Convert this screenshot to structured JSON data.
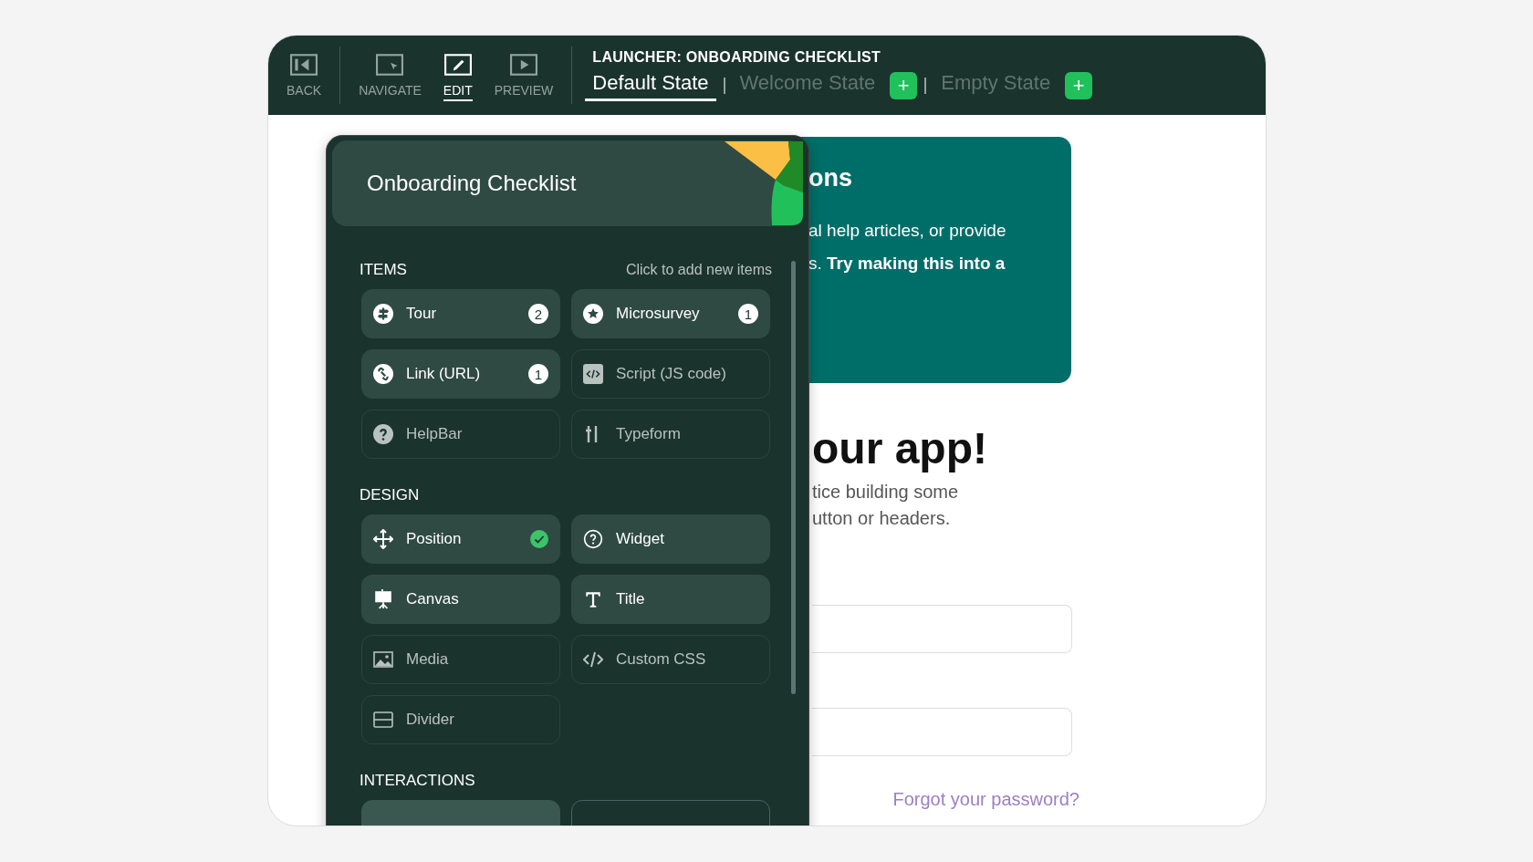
{
  "toolbar": {
    "buttons": [
      {
        "label": "BACK",
        "selected": false
      },
      {
        "label": "NAVIGATE",
        "selected": false
      },
      {
        "label": "EDIT",
        "selected": true
      },
      {
        "label": "PREVIEW",
        "selected": false
      }
    ],
    "title": "LAUNCHER: ONBOARDING CHECKLIST",
    "tabs": [
      {
        "label": "Default State",
        "selected": true,
        "add_button": false
      },
      {
        "label": "Welcome State",
        "selected": false,
        "add_button": true
      },
      {
        "label": "Empty State",
        "selected": false,
        "add_button": true
      }
    ],
    "add_label": "+"
  },
  "panel": {
    "title": "Onboarding Checklist",
    "sections": [
      {
        "title": "ITEMS",
        "hint": "Click to add new items",
        "items": [
          {
            "label": "Tour",
            "configured": true,
            "count": "2",
            "checked": false
          },
          {
            "label": "Microsurvey",
            "configured": true,
            "count": "1",
            "checked": false
          },
          {
            "label": "Link (URL)",
            "configured": true,
            "count": "1",
            "checked": false
          },
          {
            "label": "Script (JS code)",
            "configured": false,
            "checked": false
          },
          {
            "label": "HelpBar",
            "configured": false,
            "checked": false
          },
          {
            "label": "Typeform",
            "configured": false,
            "checked": false
          }
        ]
      },
      {
        "title": "DESIGN",
        "items": [
          {
            "label": "Position",
            "configured": true,
            "checked": true
          },
          {
            "label": "Widget",
            "configured": true,
            "checked": false
          },
          {
            "label": "Canvas",
            "configured": true,
            "checked": false
          },
          {
            "label": "Title",
            "configured": true,
            "checked": false
          },
          {
            "label": "Media",
            "configured": false,
            "checked": false
          },
          {
            "label": "Custom CSS",
            "configured": false,
            "checked": false
          },
          {
            "label": "Divider",
            "configured": false,
            "checked": false
          }
        ]
      },
      {
        "title": "INTERACTIONS",
        "items": [
          {
            "configured": true
          },
          {
            "configured": false
          }
        ]
      }
    ]
  },
  "page": {
    "card": {
      "heading": "ons",
      "lines": [
        "al help articles, or provide",
        "s. **Try making this into a**"
      ]
    },
    "heading": "our app!",
    "subtitle": [
      "tice building some",
      "utton or headers."
    ],
    "link": "Forgot your password?"
  }
}
